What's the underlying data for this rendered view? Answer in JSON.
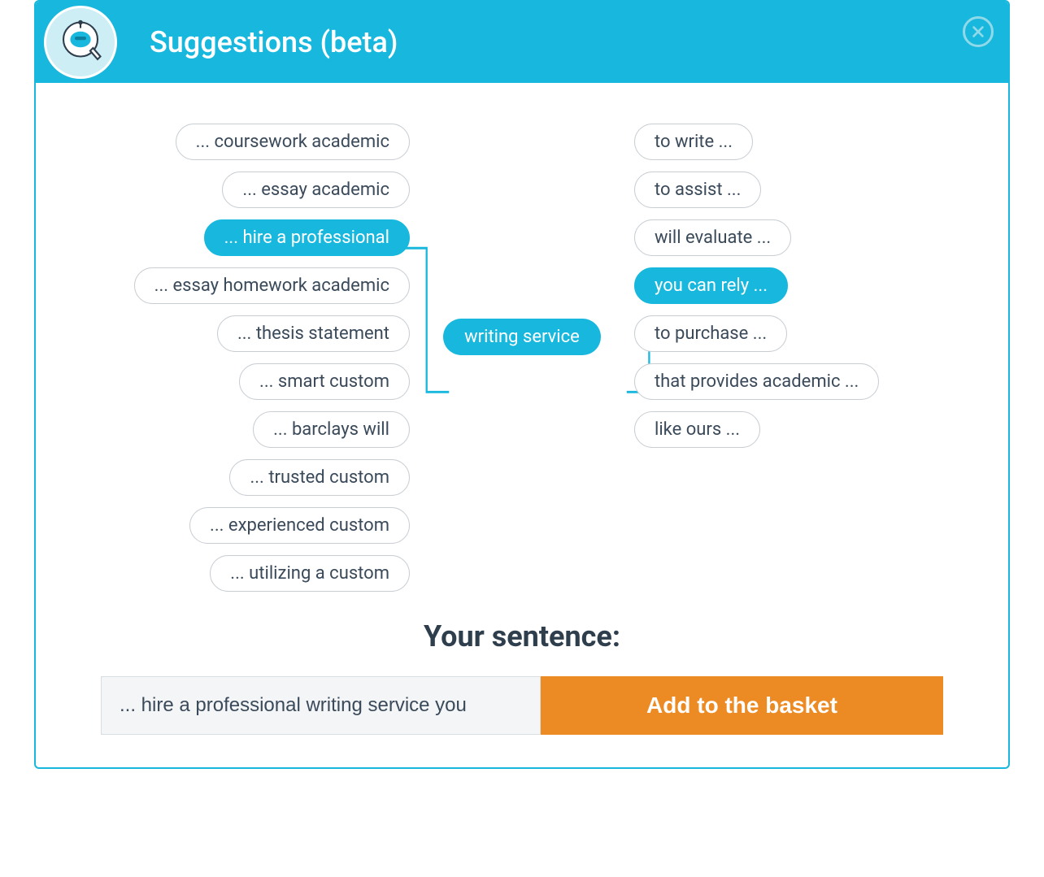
{
  "header": {
    "title": "Suggestions (beta)"
  },
  "center_pill": "writing service",
  "left_pills": [
    {
      "label": "... coursework academic",
      "selected": false
    },
    {
      "label": "... essay academic",
      "selected": false
    },
    {
      "label": "... hire a professional",
      "selected": true
    },
    {
      "label": "... essay homework academic",
      "selected": false
    },
    {
      "label": "... thesis statement",
      "selected": false
    },
    {
      "label": "... smart custom",
      "selected": false
    },
    {
      "label": "... barclays will",
      "selected": false
    },
    {
      "label": "... trusted custom",
      "selected": false
    },
    {
      "label": "... experienced custom",
      "selected": false
    },
    {
      "label": "... utilizing a custom",
      "selected": false
    }
  ],
  "right_pills": [
    {
      "label": "to write ...",
      "selected": false
    },
    {
      "label": "to assist ...",
      "selected": false
    },
    {
      "label": "will evaluate ...",
      "selected": false
    },
    {
      "label": "you can rely ...",
      "selected": true
    },
    {
      "label": "to purchase ...",
      "selected": false
    },
    {
      "label": "that provides academic ...",
      "selected": false
    },
    {
      "label": "like ours ...",
      "selected": false
    }
  ],
  "sentence": {
    "label": "Your sentence:",
    "value": "... hire a professional writing service you",
    "button": "Add to the basket"
  }
}
